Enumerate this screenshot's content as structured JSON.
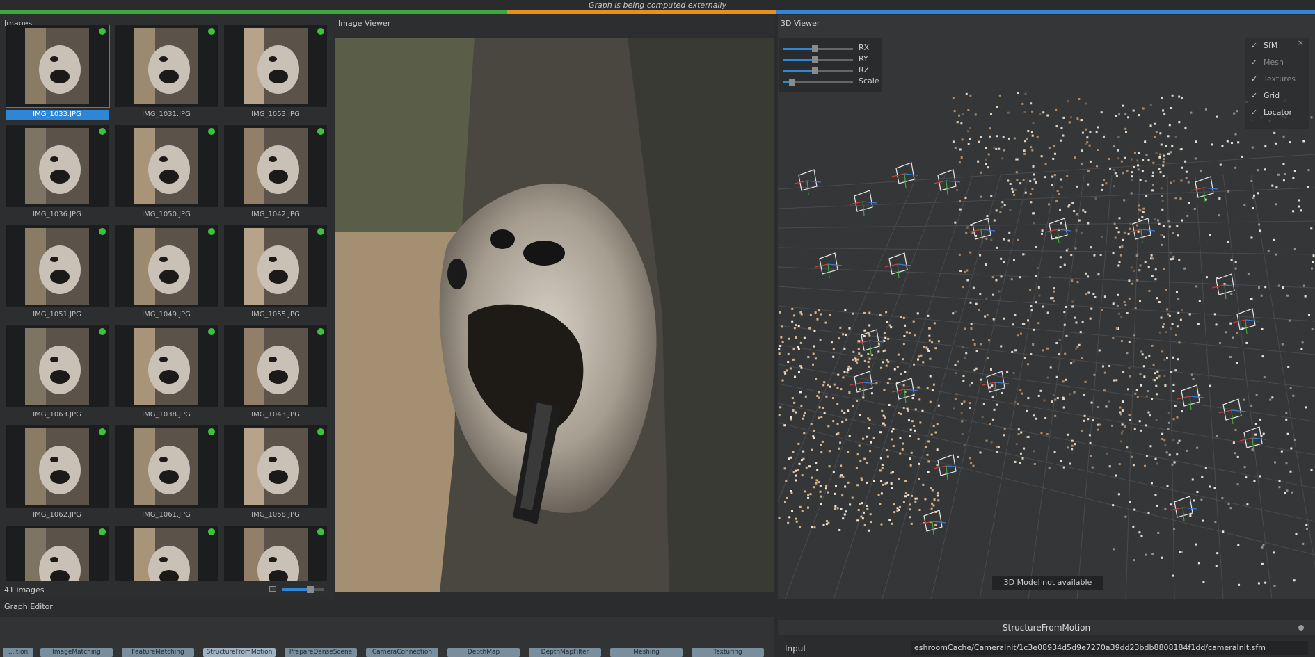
{
  "status": {
    "message": "Graph is being computed externally"
  },
  "progress": {
    "segments": [
      {
        "color": "#3fa73f",
        "fraction": 0.385
      },
      {
        "color": "#e8901c",
        "fraction": 0.205
      },
      {
        "color": "#2f86d6",
        "fraction": 0.41
      }
    ]
  },
  "images_panel": {
    "title": "Images",
    "count_label": "41 images",
    "thumb_zoom": 0.67,
    "images": [
      {
        "name": "IMG_1033.JPG",
        "selected": true
      },
      {
        "name": "IMG_1031.JPG"
      },
      {
        "name": "IMG_1053.JPG"
      },
      {
        "name": "IMG_1036.JPG"
      },
      {
        "name": "IMG_1050.JPG"
      },
      {
        "name": "IMG_1042.JPG"
      },
      {
        "name": "IMG_1051.JPG"
      },
      {
        "name": "IMG_1049.JPG"
      },
      {
        "name": "IMG_1055.JPG"
      },
      {
        "name": "IMG_1063.JPG"
      },
      {
        "name": "IMG_1038.JPG"
      },
      {
        "name": "IMG_1043.JPG"
      },
      {
        "name": "IMG_1062.JPG"
      },
      {
        "name": "IMG_1061.JPG"
      },
      {
        "name": "IMG_1058.JPG"
      },
      {
        "name": ""
      },
      {
        "name": ""
      },
      {
        "name": ""
      }
    ]
  },
  "image_viewer": {
    "title": "Image Viewer"
  },
  "viewer_3d": {
    "title": "3D Viewer",
    "gizmo": [
      {
        "label": "RX",
        "value": 0.45
      },
      {
        "label": "RY",
        "value": 0.45
      },
      {
        "label": "RZ",
        "value": 0.45
      },
      {
        "label": "Scale",
        "value": 0.12
      }
    ],
    "layers": [
      {
        "name": "SfM",
        "checked": true
      },
      {
        "name": "Mesh",
        "checked": true
      },
      {
        "name": "Textures",
        "checked": true
      },
      {
        "name": "Grid",
        "checked": true
      },
      {
        "name": "Locator",
        "checked": true
      }
    ],
    "layers_close": "×",
    "model_status": "3D Model not available"
  },
  "graph_editor": {
    "title": "Graph Editor",
    "nodes": [
      "...ition",
      "ImageMatching",
      "FeatureMatching",
      "StructureFromMotion",
      "PrepareDenseScene",
      "CameraConnection",
      "DepthMap",
      "DepthMapFilter",
      "Meshing",
      "Texturing"
    ]
  },
  "attribute_editor": {
    "node_title": "StructureFromMotion",
    "attr_label": "Input",
    "attr_value": "eshroomCache/CameraInit/1c3e08934d5d9e7270a39dd23bdb8808184f1dd/cameraInit.sfm"
  }
}
